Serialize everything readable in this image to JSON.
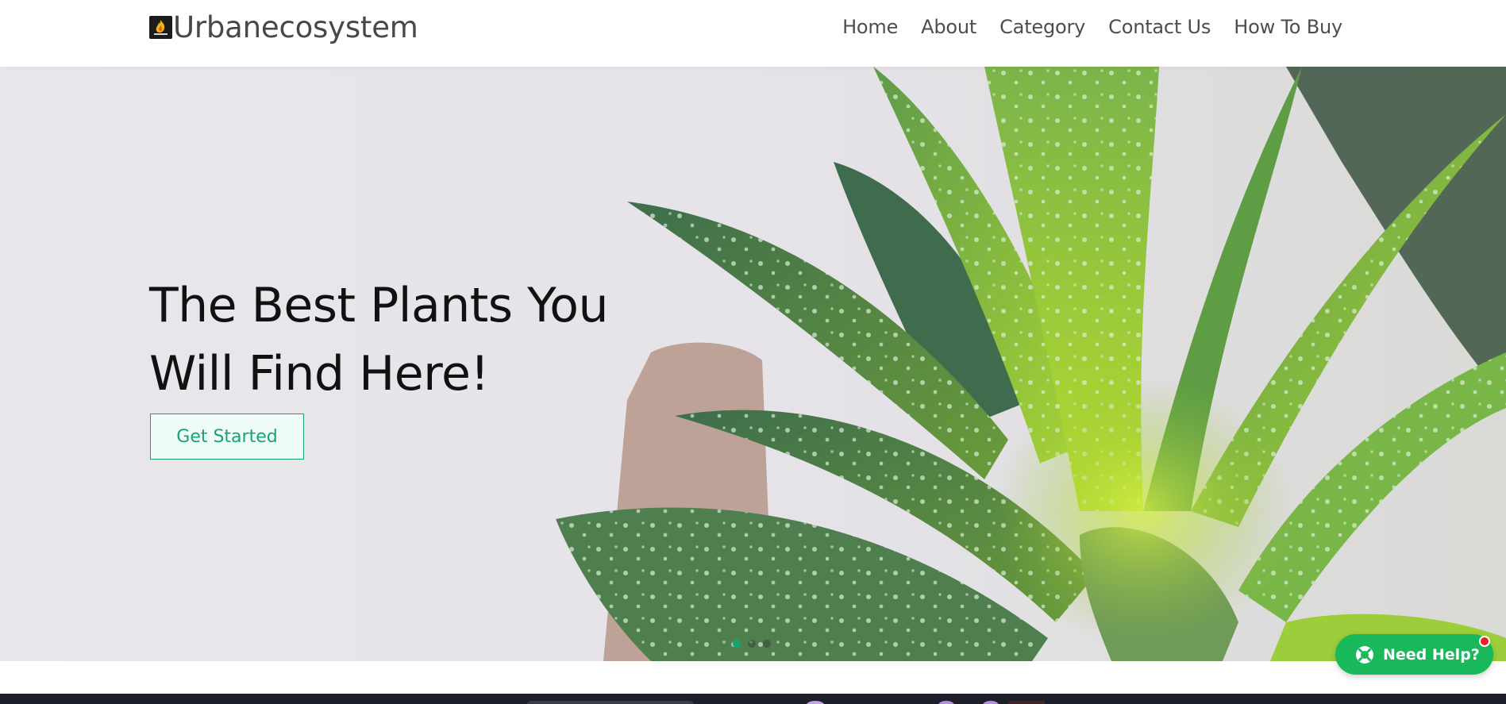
{
  "brand": {
    "name": "Urbanecosystem",
    "logo_icon": "flame-logo-icon"
  },
  "nav": {
    "items": [
      "Home",
      "About",
      "Category",
      "Contact Us",
      "How To Buy"
    ]
  },
  "hero": {
    "title_line1": "The Best Plants You",
    "title_line2": "Will Find Here!",
    "cta_label": "Get Started",
    "slides": {
      "count": 3,
      "active": 1
    }
  },
  "help": {
    "label": "Need Help?",
    "icon": "lifebuoy-icon",
    "has_notification": true
  },
  "colors": {
    "accent": "#19a46f",
    "help_green": "#18b85b",
    "notification_red": "#e8202a",
    "hero_bg": "#e7e6ea",
    "dark_strip": "#1d1f2b"
  }
}
